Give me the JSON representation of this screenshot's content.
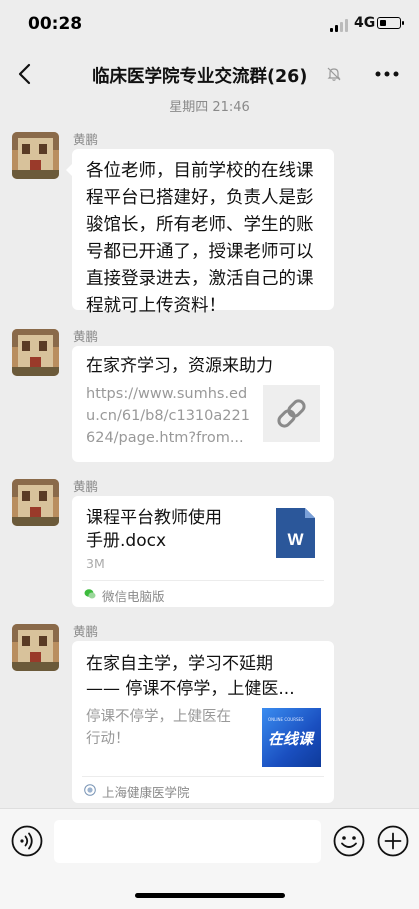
{
  "status_bar": {
    "time": "00:28",
    "network": "4G"
  },
  "header": {
    "title": "临床医学院专业交流群(26)"
  },
  "timestamp": "星期四 21:46",
  "messages": [
    {
      "sender": "黄鹏",
      "type": "text",
      "text": "各位老师，目前学校的在线课程平台已搭建好，负责人是彭骏馆长，所有老师、学生的账号都已开通了，授课老师可以直接登录进去，激活自己的课程就可上传资料！"
    },
    {
      "sender": "黄鹏",
      "type": "link",
      "title": "在家齐学习，资源来助力",
      "desc_lines": [
        "https://www.sumhs.ed",
        "u.cn/61/b8/c1310a221",
        "624/page.htm?from..."
      ]
    },
    {
      "sender": "黄鹏",
      "type": "file",
      "title_lines": [
        "课程平台教师使用",
        "手册.docx"
      ],
      "size": "3M",
      "icon_letter": "W",
      "source": "微信电脑版"
    },
    {
      "sender": "黄鹏",
      "type": "article",
      "title_lines": [
        "在家自主学，学习不延期",
        "—— 停课不停学，上健医..."
      ],
      "desc_lines": [
        "停课不停学，上健医在",
        "行动！"
      ],
      "thumb_small": "ONLINE COURSES",
      "thumb_text": "在线课",
      "source": "上海健康医学院"
    }
  ],
  "colors": {
    "word_blue": "#2b579a",
    "thumb_blue": "#1f5fd1",
    "page_bg": "#ededed"
  }
}
